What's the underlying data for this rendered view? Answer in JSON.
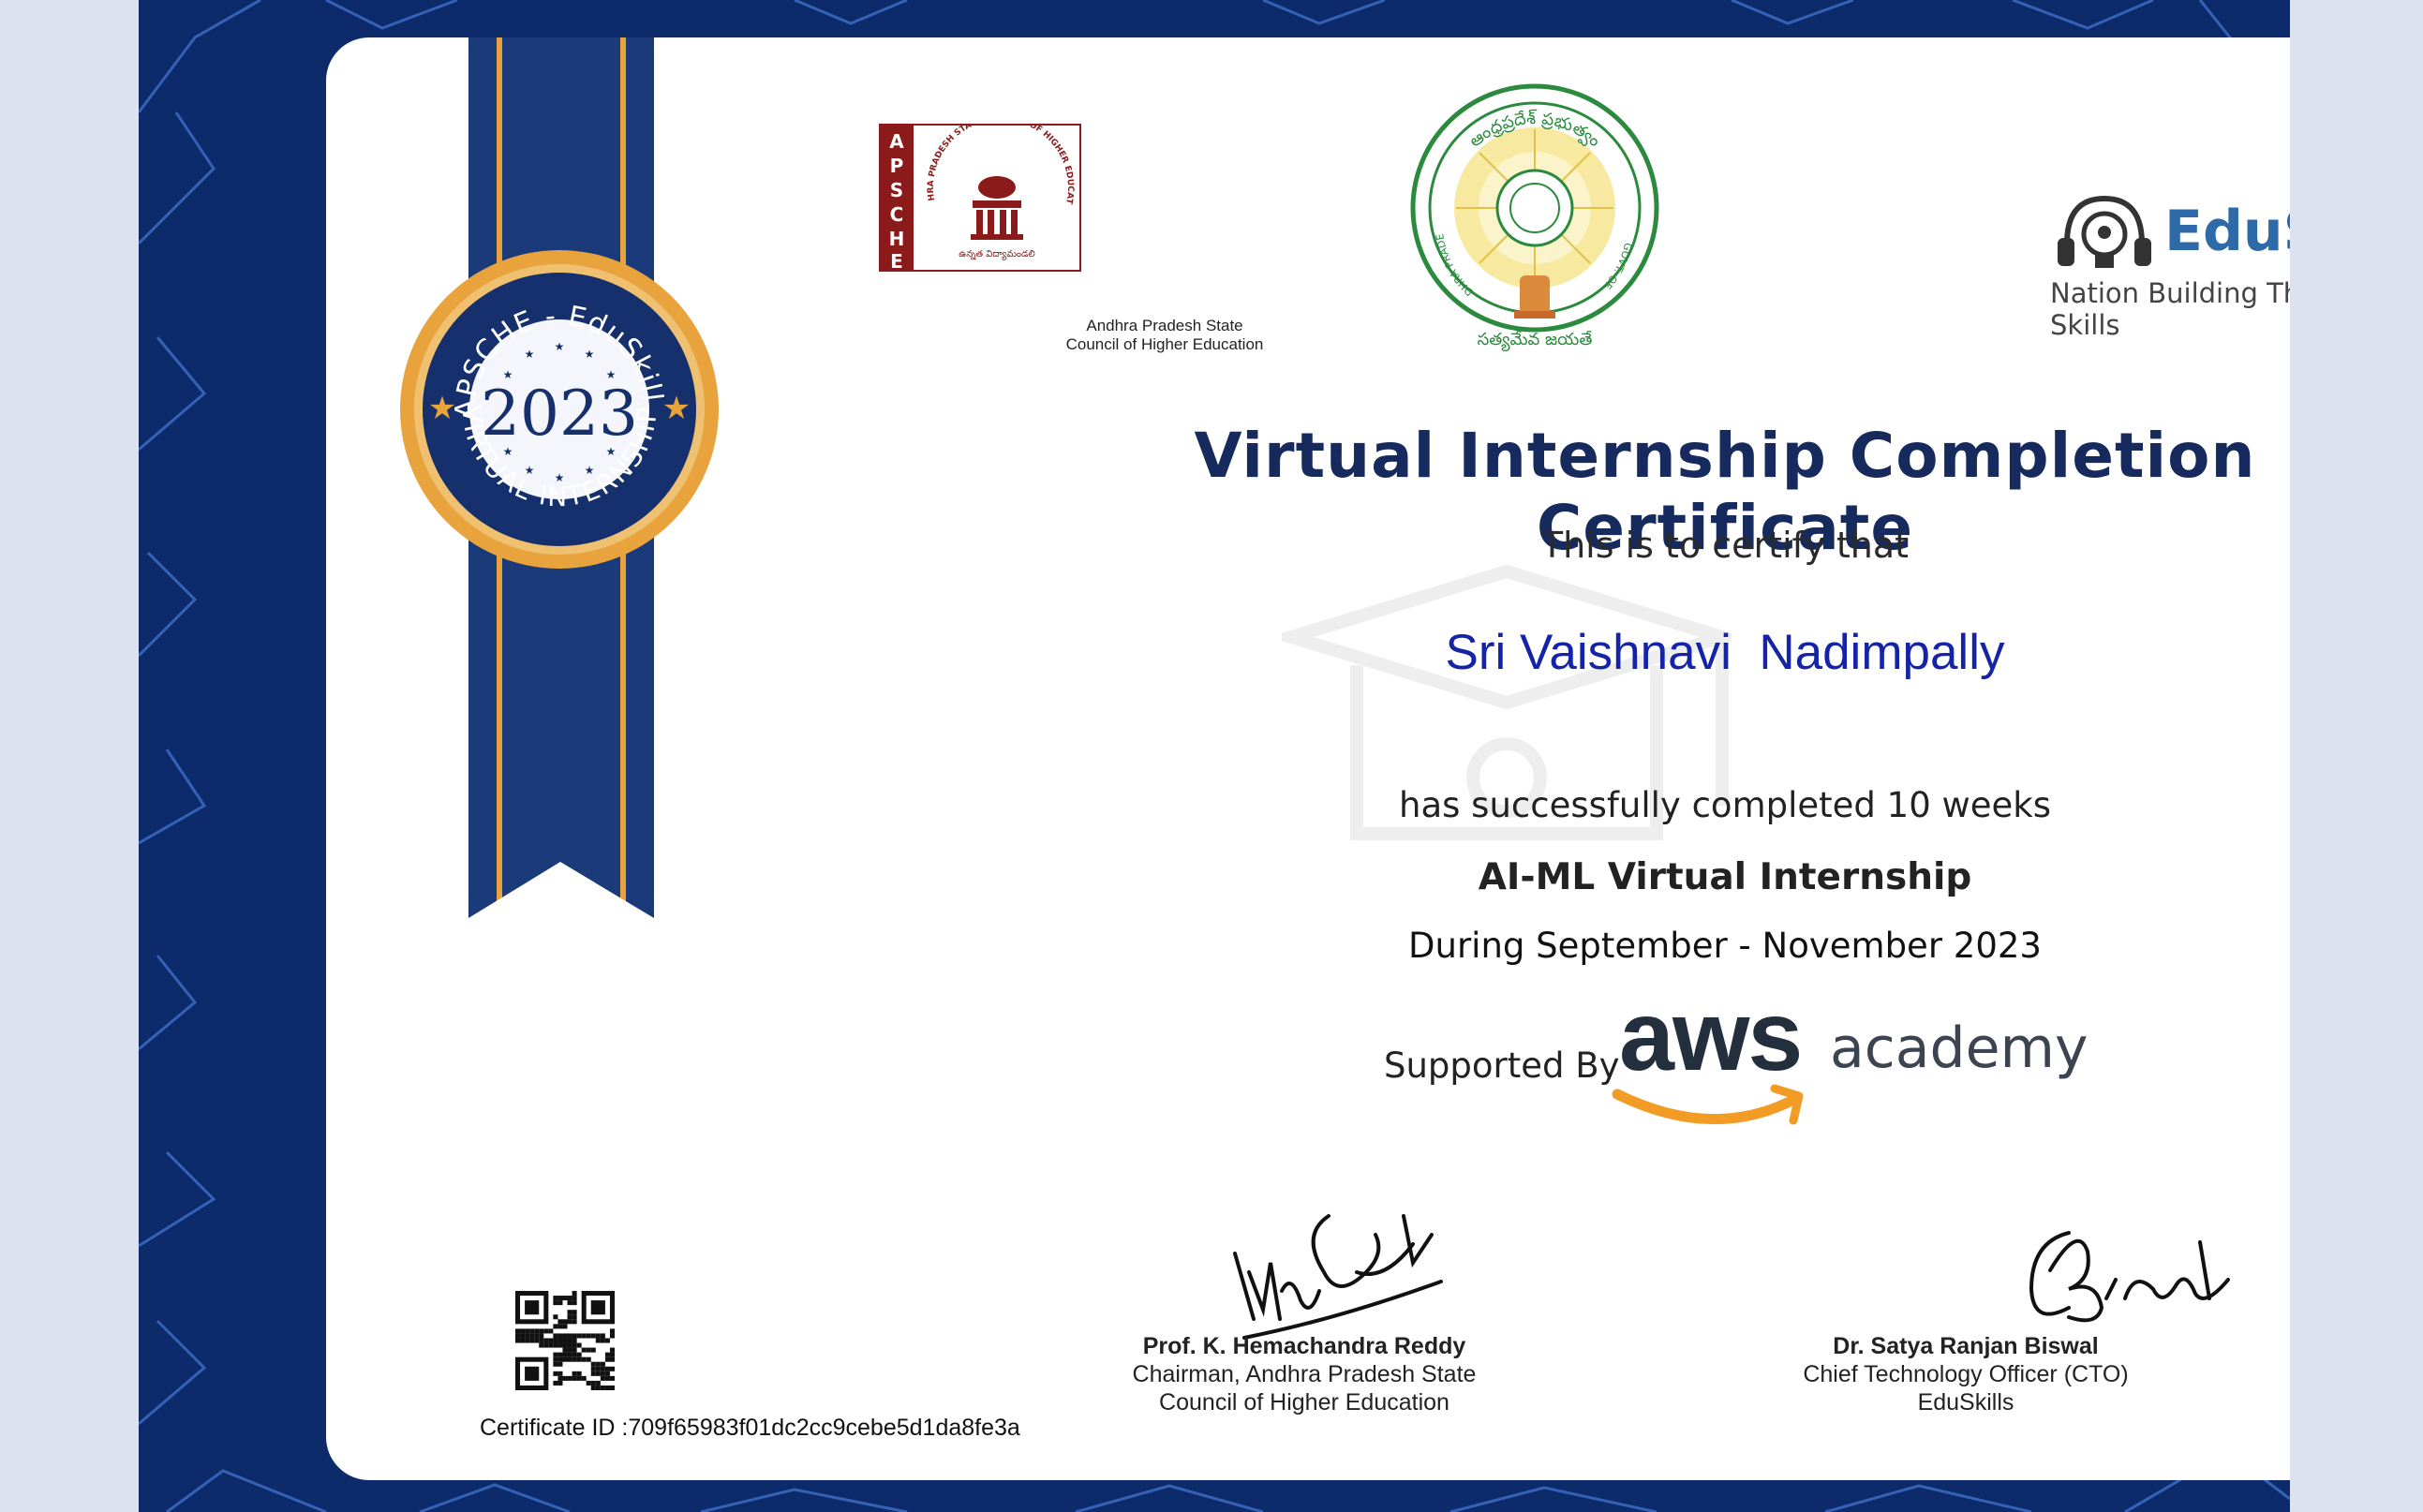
{
  "logos": {
    "apsche_letters": "APSCHE",
    "apsche_ring_text": "ANDHRA PRADESH STATE COUNCIL OF HIGHER EDUCATION",
    "apsche_telugu": "ఉన్నత విద్యామండలి",
    "apsche_caption_line1": "Andhra Pradesh State",
    "apsche_caption_line2": "Council of Higher Education",
    "ap_emblem_top_text": "ఆంధ్రప్రదేశ్ ప్రభుత్వం",
    "ap_emblem_left_text": "ANDHRA PRADESH",
    "ap_emblem_right_text": "GOVT. OF",
    "ap_emblem_bottom_text": "సత్యమేవ జయతే",
    "eduskills_name": "EduSkills",
    "eduskills_registered": "®",
    "eduskills_tagline": "Nation Building Through Skills"
  },
  "seal": {
    "top_text": "APSCHE - EduSkills",
    "year": "2023",
    "bottom_text": "VIRTUAL INTERNSHIP"
  },
  "certificate": {
    "title": "Virtual Internship Completion Certificate",
    "certify_line": "This is to certify that",
    "recipient_name": "Sri Vaishnavi  Nadimpally",
    "completed_line": "has successfully completed 10 weeks",
    "program": "AI-ML Virtual Internship",
    "period": "During September - November 2023",
    "supported_by": "Supported By",
    "sponsor_brand": "aws",
    "sponsor_product": "academy"
  },
  "signatories": [
    {
      "name": "Prof. K. Hemachandra Reddy",
      "title_line1": "Chairman, Andhra Pradesh State",
      "title_line2": "Council of Higher Education"
    },
    {
      "name": "Dr. Satya Ranjan Biswal",
      "title_line1": "Chief Technology Officer (CTO)",
      "title_line2": "EduSkills"
    }
  ],
  "certificate_id": "Certificate ID :709f65983f01dc2cc9cebe5d1da8fe3a",
  "colors": {
    "frame_navy": "#0d2a6b",
    "title_navy": "#162a5e",
    "name_blue": "#1524a6",
    "ribbon_gold": "#e8a33d",
    "aws_orange": "#f29c26"
  }
}
